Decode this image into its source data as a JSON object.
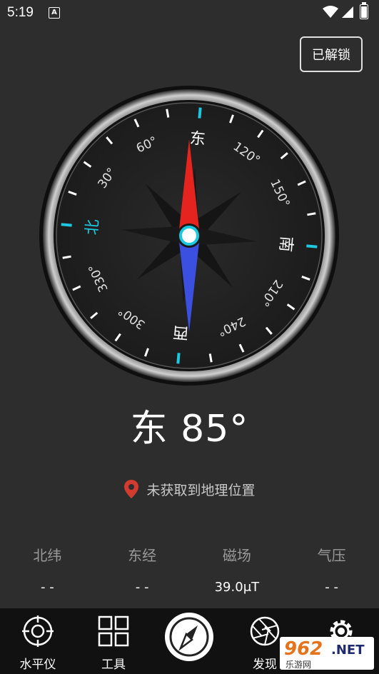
{
  "status_bar": {
    "time": "5:19",
    "notification_icon": "A"
  },
  "unlock_button": "已解锁",
  "compass": {
    "cardinals": {
      "north": "北",
      "east": "东",
      "south": "南",
      "west": "西"
    },
    "degree_labels": [
      "30°",
      "60°",
      "120°",
      "150°",
      "210°",
      "240°",
      "300°",
      "330°"
    ],
    "accent_color": "#1ec8e0",
    "needle_north_color": "#e52420",
    "needle_south_color": "#3b4fe0"
  },
  "heading": {
    "text": "东 85°"
  },
  "location": {
    "icon": "location-pin-icon",
    "text": "未获取到地理位置",
    "icon_color": "#d23b2f"
  },
  "stats": [
    {
      "label": "北纬",
      "value": "- -"
    },
    {
      "label": "东经",
      "value": "- -"
    },
    {
      "label": "磁场",
      "value": "39.0μT"
    },
    {
      "label": "气压",
      "value": "- -"
    }
  ],
  "nav": {
    "level": "水平仪",
    "tools": "工具",
    "discover": "发现",
    "settings": "设置"
  },
  "watermark": {
    "brand": "962",
    "net": ".NET",
    "sub": "乐游网"
  }
}
